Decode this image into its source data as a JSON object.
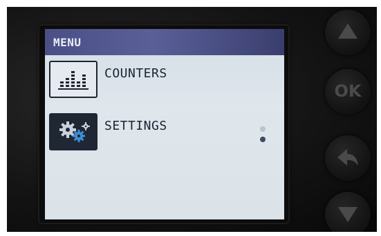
{
  "menu": {
    "title": "MENU",
    "items": [
      {
        "label": "COUNTERS",
        "icon": "bar-chart-icon",
        "selected": false
      },
      {
        "label": "SETTINGS",
        "icon": "gears-icon",
        "selected": true
      }
    ],
    "scroll": {
      "pages": 2,
      "current": 2
    }
  },
  "buttons": {
    "up": {
      "icon": "arrow-up-icon"
    },
    "ok": {
      "label": "OK"
    },
    "back": {
      "icon": "back-arrow-icon"
    },
    "down": {
      "icon": "arrow-down-icon"
    }
  },
  "colors": {
    "titlebar": "#4a4f86",
    "screen": "#dbe2e8",
    "text": "#1d2330",
    "selected_icon_bg": "#1e2733",
    "gear_blue": "#3f8fd9",
    "button_glyph": "#4a4a4a"
  }
}
